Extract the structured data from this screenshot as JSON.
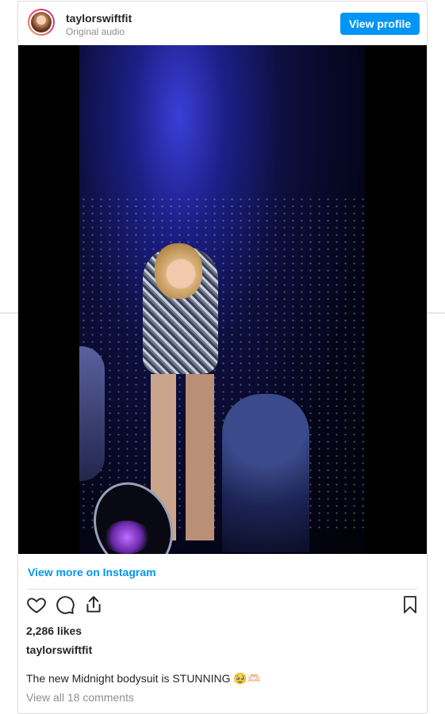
{
  "header": {
    "username": "taylorswiftfit",
    "audio": "Original audio",
    "view_profile_label": "View profile"
  },
  "post": {
    "view_more_label": "View more on Instagram",
    "likes": "2,286 likes",
    "owner": "taylorswiftfit",
    "caption": "The new Midnight bodysuit is STUNNING 🥹🫶🏻",
    "comments_link": "View all 18 comments"
  },
  "icons": [
    "heart-icon",
    "comment-icon",
    "share-icon",
    "bookmark-icon"
  ],
  "colors": {
    "accent": "#0095f6",
    "text": "#262626",
    "muted": "#8e8e8e"
  }
}
